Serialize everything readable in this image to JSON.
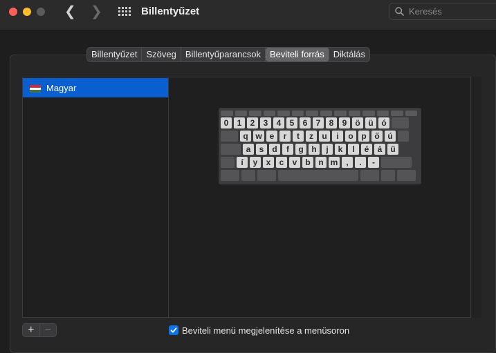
{
  "window": {
    "title": "Billentyűzet"
  },
  "search": {
    "placeholder": "Keresés"
  },
  "tabs": [
    {
      "label": "Billentyűzet",
      "selected": false
    },
    {
      "label": "Szöveg",
      "selected": false
    },
    {
      "label": "Billentyűparancsok",
      "selected": false
    },
    {
      "label": "Beviteli forrás",
      "selected": true
    },
    {
      "label": "Diktálás",
      "selected": false
    }
  ],
  "input_sources": [
    {
      "label": "Magyar",
      "flag": "hungary-flag",
      "selected": true
    }
  ],
  "flag_colors": [
    "#ce2939",
    "#ffffff",
    "#477050"
  ],
  "keyboard": {
    "row1": [
      "0",
      "1",
      "2",
      "3",
      "4",
      "5",
      "6",
      "7",
      "8",
      "9",
      "ö",
      "ü",
      "ó"
    ],
    "row2": [
      "q",
      "w",
      "e",
      "r",
      "t",
      "z",
      "u",
      "i",
      "o",
      "p",
      "ő",
      "ú"
    ],
    "row3": [
      "a",
      "s",
      "d",
      "f",
      "g",
      "h",
      "j",
      "k",
      "l",
      "é",
      "á",
      "ű"
    ],
    "row4": [
      "í",
      "y",
      "x",
      "c",
      "v",
      "b",
      "n",
      "m",
      ",",
      ".",
      "-"
    ]
  },
  "buttons": {
    "add": "+",
    "remove": "−"
  },
  "show_input_menu": {
    "label": "Beviteli menü megjelenítése a menüsoron",
    "checked": true
  },
  "colors": {
    "accent": "#0a5fd0",
    "checkbox": "#0a74e8"
  }
}
